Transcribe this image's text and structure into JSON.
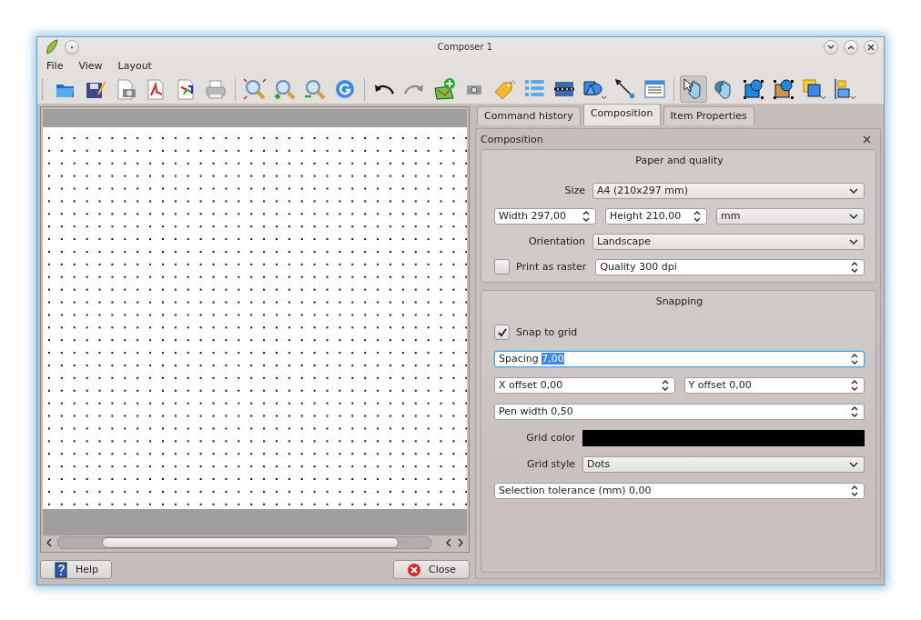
{
  "window": {
    "title": "Composer 1"
  },
  "menu": [
    "File",
    "View",
    "Layout"
  ],
  "toolbar": [
    [
      {
        "kind": "open",
        "selected": false
      },
      {
        "kind": "save",
        "selected": false
      },
      {
        "kind": "export-image",
        "selected": false
      },
      {
        "kind": "export-pdf",
        "selected": false
      },
      {
        "kind": "export-svg",
        "selected": false
      },
      {
        "kind": "print",
        "selected": false
      }
    ],
    [
      {
        "kind": "zoom-full",
        "selected": false
      },
      {
        "kind": "zoom-in",
        "selected": false
      },
      {
        "kind": "zoom-out",
        "selected": false
      },
      {
        "kind": "refresh",
        "selected": false
      }
    ],
    [
      {
        "kind": "undo",
        "selected": false
      },
      {
        "kind": "redo",
        "selected": false
      },
      {
        "kind": "add-map",
        "selected": false
      },
      {
        "kind": "add-image",
        "selected": false
      },
      {
        "kind": "add-label",
        "selected": false
      },
      {
        "kind": "add-legend",
        "selected": false
      },
      {
        "kind": "add-scalebar",
        "selected": false
      },
      {
        "kind": "add-shape",
        "selected": false
      },
      {
        "kind": "add-arrow",
        "selected": false
      },
      {
        "kind": "add-table",
        "selected": false
      }
    ],
    [
      {
        "kind": "select",
        "selected": true
      },
      {
        "kind": "move-content",
        "selected": false
      },
      {
        "kind": "group",
        "selected": false
      },
      {
        "kind": "ungroup",
        "selected": false
      },
      {
        "kind": "raise",
        "selected": false
      },
      {
        "kind": "align",
        "selected": false
      }
    ]
  ],
  "buttons": [
    {
      "label": "Help",
      "kind": "help"
    },
    {
      "label": "Close",
      "kind": "close"
    }
  ],
  "tabs": [
    {
      "label": "Command history",
      "selected": false
    },
    {
      "label": "Composition",
      "selected": true
    },
    {
      "label": "Item Properties",
      "selected": false
    }
  ],
  "dock": {
    "title": "Composition"
  },
  "paper": {
    "title": "Paper and quality",
    "size_label": "Size",
    "size": "A4 (210x297 mm)",
    "width": "Width 297,00",
    "height": "Height 210,00",
    "units": "mm",
    "orientation_label": "Orientation",
    "orientation": "Landscape",
    "print_as_raster": {
      "label": "Print as raster",
      "checked": false
    },
    "quality": "Quality 300 dpi"
  },
  "snapping": {
    "title": "Snapping",
    "snap_to_grid": {
      "label": "Snap to grid",
      "checked": true
    },
    "spacing": {
      "label": "Spacing",
      "value": "7,00",
      "focused": true
    },
    "x_offset": "X offset 0,00",
    "y_offset": "Y offset 0,00",
    "pen_width": "Pen width 0,50",
    "grid_color_label": "Grid color",
    "grid_color": {
      "color": "#000000"
    },
    "grid_style_label": "Grid style",
    "grid_style": "Dots",
    "selection_tolerance": "Selection tolerance (mm) 0,00"
  }
}
